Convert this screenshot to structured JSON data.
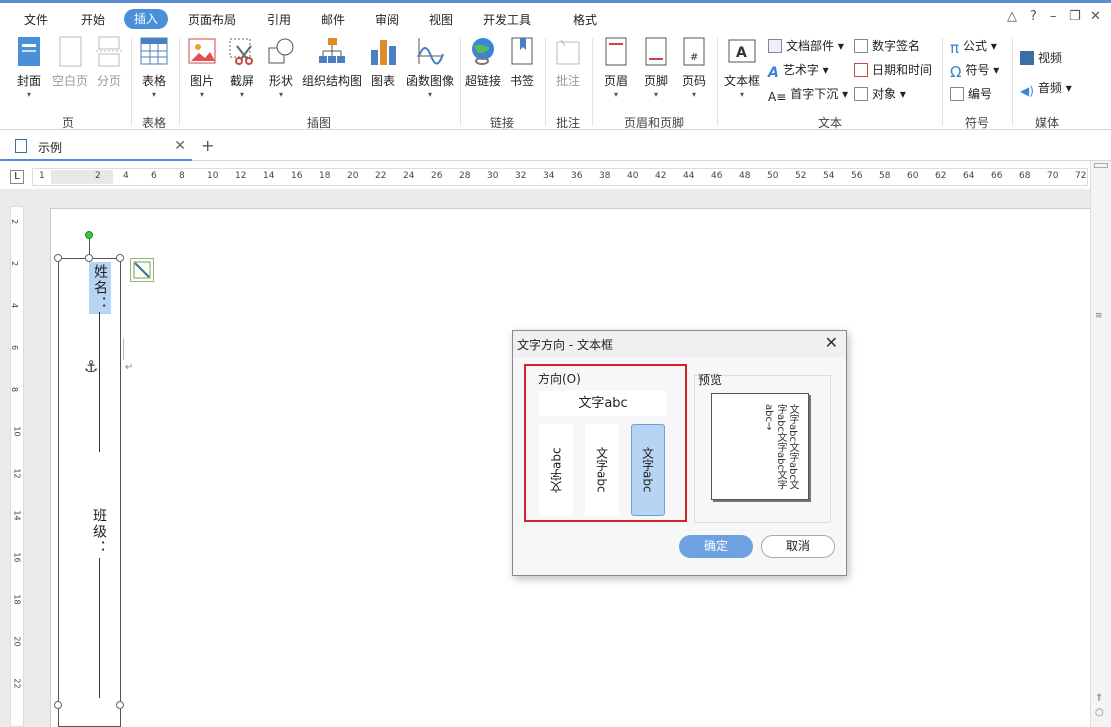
{
  "menu": {
    "items": [
      "文件",
      "开始",
      "插入",
      "页面布局",
      "引用",
      "邮件",
      "审阅",
      "视图",
      "开发工具",
      "格式"
    ],
    "active": "插入"
  },
  "ribbon": {
    "page_group": {
      "label": "页",
      "cover": "封面",
      "blank": "空白页",
      "break": "分页"
    },
    "table_group": {
      "label": "表格",
      "table": "表格"
    },
    "illus_group": {
      "label": "插图",
      "picture": "图片",
      "screenshot": "截屏",
      "shapes": "形状",
      "org": "组织结构图",
      "chart": "图表",
      "func": "函数图像"
    },
    "link_group": {
      "label": "链接",
      "hyperlink": "超链接",
      "bookmark": "书签"
    },
    "comment_group": {
      "label": "批注",
      "comment": "批注"
    },
    "hf_group": {
      "label": "页眉和页脚",
      "header": "页眉",
      "footer": "页脚",
      "pagenum": "页码"
    },
    "text_group": {
      "label": "文本",
      "textbox": "文本框",
      "docparts": "文档部件",
      "wordart": "艺术字",
      "dropcap": "首字下沉",
      "signature": "数字签名",
      "datetime": "日期和时间",
      "object": "对象"
    },
    "symbol_group": {
      "label": "符号",
      "formula": "公式",
      "symbol": "符号",
      "number": "编号"
    },
    "media_group": {
      "label": "媒体",
      "video": "视频",
      "audio": "音频"
    }
  },
  "tabs": {
    "doc_name": "示例"
  },
  "ruler": {
    "marker": "L",
    "h_numbers": [
      "1",
      "2",
      "4",
      "6",
      "8",
      "10",
      "12",
      "14",
      "16",
      "18",
      "20",
      "22",
      "24",
      "26",
      "28",
      "30",
      "32",
      "34",
      "36",
      "38",
      "40",
      "42",
      "44",
      "46",
      "48",
      "50",
      "52",
      "54",
      "56",
      "58",
      "60",
      "62",
      "64",
      "66",
      "68",
      "70",
      "72"
    ],
    "v_numbers": [
      "2",
      "2",
      "4",
      "6",
      "8",
      "10",
      "12",
      "14",
      "16",
      "18",
      "20",
      "22"
    ]
  },
  "document": {
    "name_label": "姓名：",
    "class_label": "班级：",
    "anchor": "⚓",
    "para_mark": "↵"
  },
  "dialog": {
    "title": "文字方向 - 文本框",
    "direction_label": "方向(O)",
    "option_horizontal": "文字abc",
    "option_v1": "文字abc",
    "option_v2": "文字abc",
    "option_v3": "文字abc",
    "preview_label": "预览",
    "preview_text": "文字abc文字abc文字abc文字abc文字abc→",
    "ok": "确定",
    "cancel": "取消"
  },
  "colors": {
    "accent": "#4a90d9",
    "highlight_red": "#d0242a",
    "selected_option": "#b8d4f5"
  }
}
